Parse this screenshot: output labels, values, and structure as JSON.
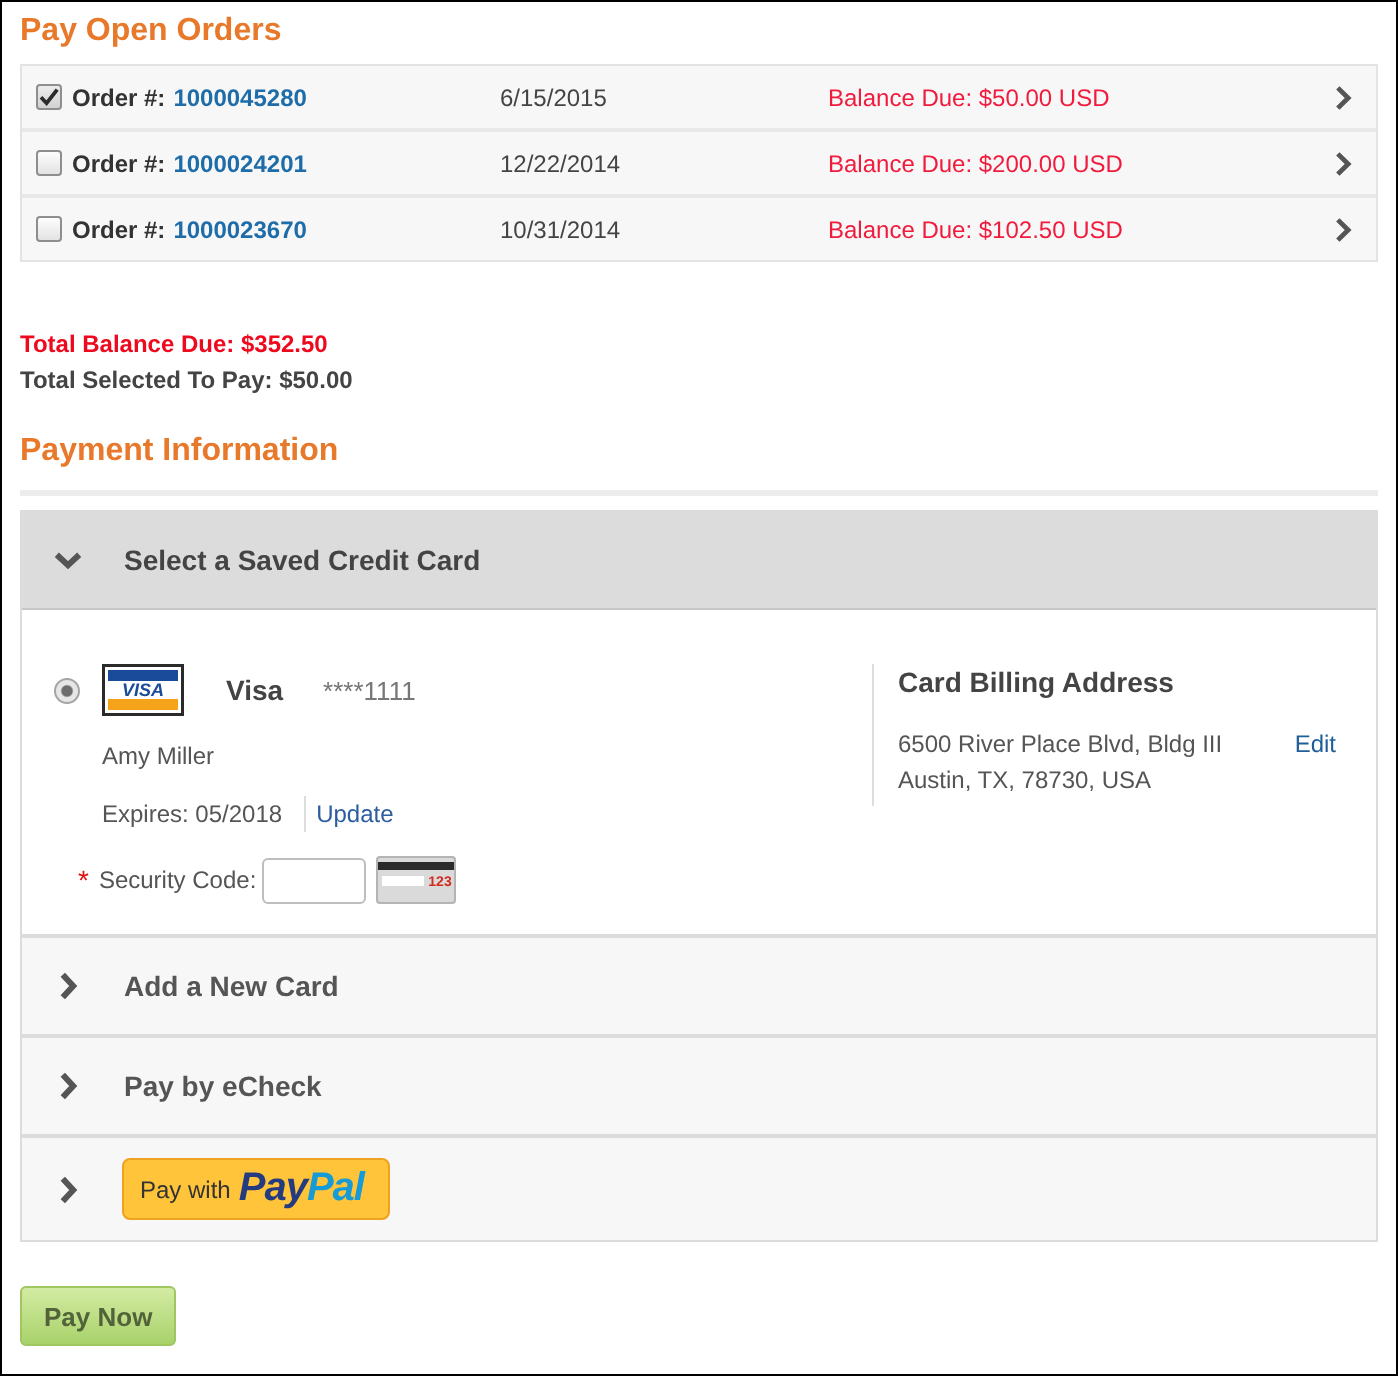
{
  "orders": {
    "title": "Pay Open Orders",
    "rows": [
      {
        "checked": true,
        "label": "Order #:",
        "number": "1000045280",
        "date": "6/15/2015",
        "balance": "Balance Due: $50.00 USD"
      },
      {
        "checked": false,
        "label": "Order #:",
        "number": "1000024201",
        "date": "12/22/2014",
        "balance": "Balance Due: $200.00 USD"
      },
      {
        "checked": false,
        "label": "Order #:",
        "number": "1000023670",
        "date": "10/31/2014",
        "balance": "Balance Due: $102.50 USD"
      }
    ]
  },
  "totals": [
    {
      "kind": "due",
      "text": "Total Balance Due: $352.50"
    },
    {
      "kind": "selected",
      "text": "Total Selected To Pay: $50.00"
    }
  ],
  "payment": {
    "title": "Payment Information",
    "panels": [
      {
        "kind": "saved_card",
        "title": "Select a Saved Credit Card",
        "expanded": true,
        "card": {
          "selected": true,
          "logo_text": "VISA",
          "brand": "Visa",
          "number": "****1111",
          "holder": "Amy Miller",
          "expires": "Expires: 05/2018",
          "update": "Update",
          "required_mark": "*",
          "security_label": "Security Code:",
          "cvv_hint": "123",
          "billing": {
            "title": "Card Billing Address",
            "lines": [
              "6500 River Place Blvd, Bldg III",
              "Austin, TX, 78730, USA"
            ],
            "edit": "Edit"
          }
        }
      },
      {
        "kind": "new_card",
        "title": "Add a New Card",
        "expanded": false
      },
      {
        "kind": "echeck",
        "title": "Pay by eCheck",
        "expanded": false
      },
      {
        "kind": "paypal",
        "expanded": false,
        "button": {
          "prefix": "Pay with",
          "logo_parts": [
            "Pay",
            "Pal"
          ]
        }
      }
    ]
  },
  "pay_button": "Pay Now"
}
